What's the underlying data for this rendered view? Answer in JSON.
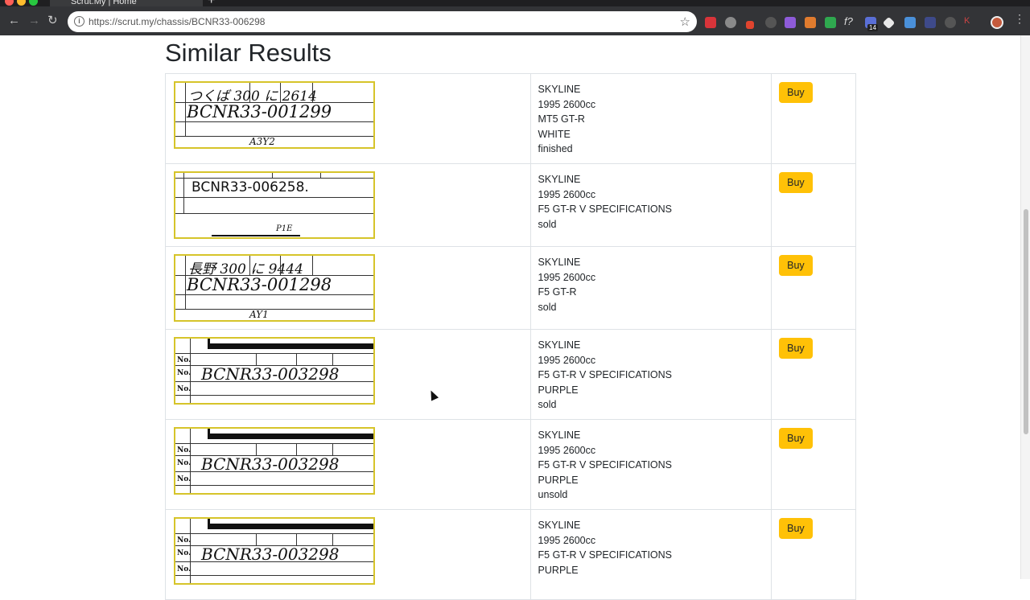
{
  "browser": {
    "tab_title": "Scrut.My | Home",
    "url": "https://scrut.my/chassis/BCNR33-006298",
    "badge": "14"
  },
  "page": {
    "heading": "Similar Results",
    "buy_label": "Buy"
  },
  "results": [
    {
      "chassis": "BCNR33-001299",
      "top_text": "つくば 300 に 2614",
      "bottom_text": "A3Y2",
      "style": "A",
      "lines": [
        "SKYLINE",
        "1995 2600cc",
        "MT5 GT-R",
        "WHITE",
        "finished"
      ]
    },
    {
      "chassis": "BCNR33-006258.",
      "top_text": "",
      "bottom_text": "P1E",
      "style": "B",
      "lines": [
        "SKYLINE",
        "1995 2600cc",
        "F5 GT-R V SPECIFICATIONS",
        "sold"
      ]
    },
    {
      "chassis": "BCNR33-001298",
      "top_text": "長野 300 に 9444",
      "bottom_text": "AY1",
      "style": "A",
      "lines": [
        "SKYLINE",
        "1995 2600cc",
        "F5 GT-R",
        "sold"
      ]
    },
    {
      "chassis": "BCNR33-003298",
      "top_text": "",
      "bottom_text": "",
      "style": "C",
      "lines": [
        "SKYLINE",
        "1995 2600cc",
        "F5 GT-R V SPECIFICATIONS",
        "PURPLE",
        "sold"
      ]
    },
    {
      "chassis": "BCNR33-003298",
      "top_text": "",
      "bottom_text": "",
      "style": "C",
      "lines": [
        "SKYLINE",
        "1995 2600cc",
        "F5 GT-R V SPECIFICATIONS",
        "PURPLE",
        "unsold"
      ]
    },
    {
      "chassis": "BCNR33-003298",
      "top_text": "",
      "bottom_text": "",
      "style": "C",
      "lines": [
        "SKYLINE",
        "1995 2600cc",
        "F5 GT-R V SPECIFICATIONS",
        "PURPLE"
      ]
    }
  ],
  "colors": {
    "buy_button": "#ffc107",
    "image_border": "#d6c42a"
  }
}
